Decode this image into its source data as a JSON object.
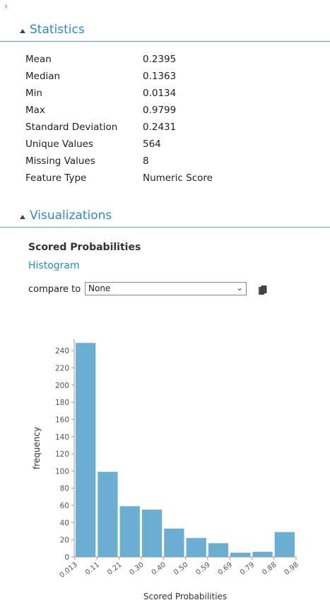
{
  "header": {
    "expand_glyph": "›"
  },
  "statistics": {
    "title": "Statistics",
    "rows": [
      {
        "label": "Mean",
        "value": "0.2395"
      },
      {
        "label": "Median",
        "value": "0.1363"
      },
      {
        "label": "Min",
        "value": "0.0134"
      },
      {
        "label": "Max",
        "value": "0.9799"
      },
      {
        "label": "Standard Deviation",
        "value": "0.2431"
      },
      {
        "label": "Unique Values",
        "value": "564"
      },
      {
        "label": "Missing Values",
        "value": "8"
      },
      {
        "label": "Feature Type",
        "value": "Numeric Score"
      }
    ]
  },
  "visualizations": {
    "title": "Visualizations",
    "subtitle": "Scored Probabilities",
    "link": "Histogram",
    "compare_label": "compare to",
    "compare_value": "None"
  },
  "chart_data": {
    "type": "bar",
    "categories": [
      "0.013",
      "0.11",
      "0.21",
      "0.30",
      "0.40",
      "0.50",
      "0.59",
      "0.69",
      "0.79",
      "0.88",
      "0.98"
    ],
    "values": [
      249,
      99,
      59,
      55,
      33,
      22,
      16,
      5,
      6,
      29
    ],
    "xlabel": "Scored Probabilities",
    "ylabel": "frequency",
    "yticks": [
      0,
      20,
      40,
      60,
      80,
      100,
      120,
      140,
      160,
      180,
      200,
      220,
      240
    ],
    "ylim": [
      0,
      250
    ],
    "bar_color": "#6aaed1",
    "grid": false
  }
}
